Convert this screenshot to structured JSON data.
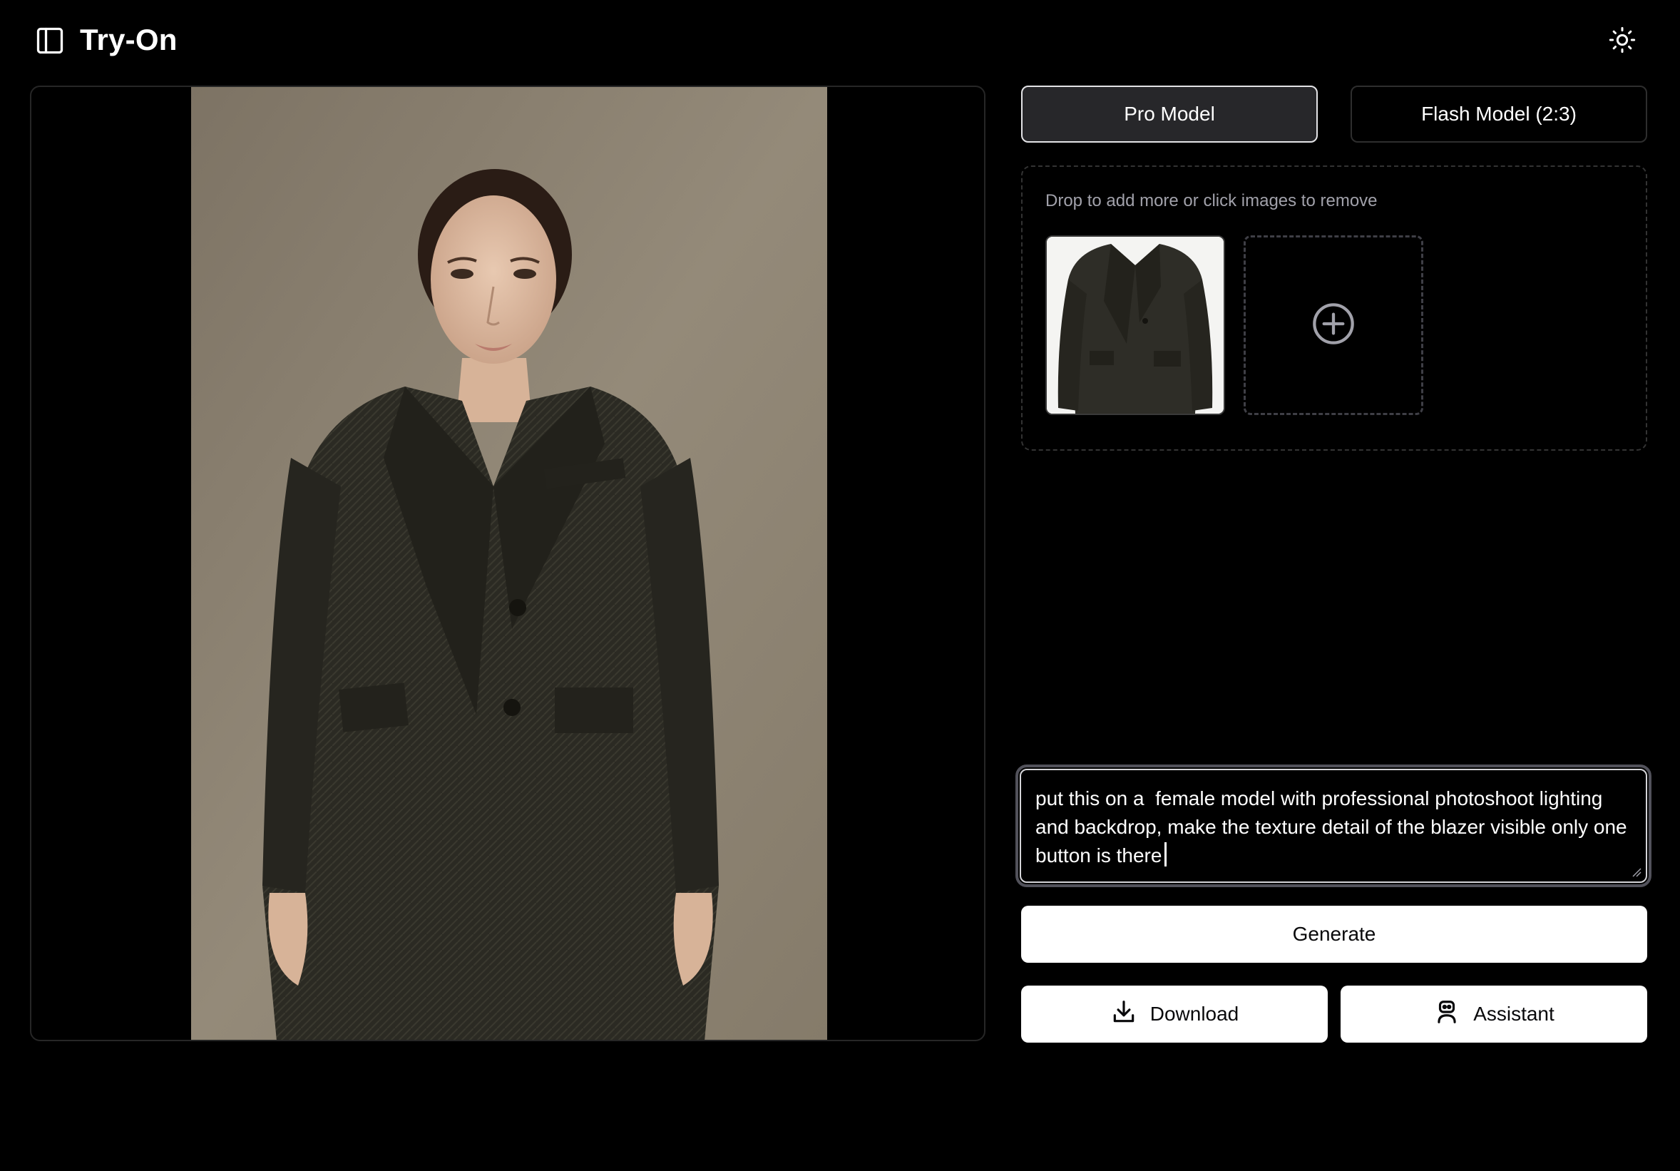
{
  "header": {
    "title": "Try-On",
    "sidebar_toggle_icon": "sidebar-panel-icon",
    "theme_toggle_icon": "sun-icon"
  },
  "preview": {
    "image_description_icon": "generated-model-photo"
  },
  "model_selector": {
    "options": [
      {
        "label": "Pro Model",
        "selected": true
      },
      {
        "label": "Flash Model (2:3)",
        "selected": false
      }
    ]
  },
  "dropzone": {
    "hint": "Drop to add more or click images to remove",
    "add_icon": "plus-circle-icon"
  },
  "prompt": {
    "value": "put this on a  female model with professional photoshoot lighting and backdrop, make the texture detail of the blazer visible only one button is there"
  },
  "actions": {
    "generate_label": "Generate",
    "download_label": "Download",
    "download_icon": "download-icon",
    "assistant_label": "Assistant",
    "assistant_icon": "robot-icon"
  },
  "colors": {
    "background": "#000000",
    "selected_button": "#27272a",
    "primary_button": "#ffffff",
    "muted_text": "#a1a1aa",
    "photo_backdrop": "#8b8070",
    "blazer": "#2c2b24"
  }
}
